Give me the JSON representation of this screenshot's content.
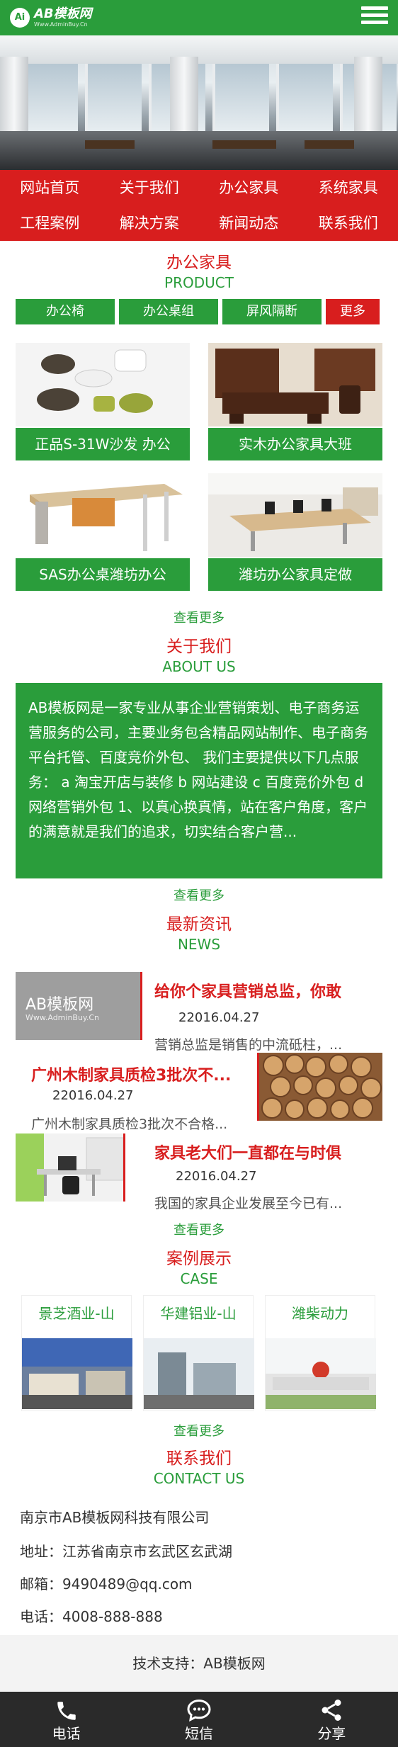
{
  "header": {
    "logo_mark": "Ai",
    "logo_title": "AB模板网",
    "logo_subtitle": "Www.AdminBuy.Cn",
    "menu_icon": "hamburger-icon"
  },
  "nav": [
    "网站首页",
    "关于我们",
    "办公家具",
    "系统家具",
    "工程案例",
    "解决方案",
    "新闻动态",
    "联系我们"
  ],
  "product": {
    "title_cn": "办公家具",
    "title_en": "PRODUCT",
    "tabs": [
      "办公椅",
      "办公桌组",
      "屏风隔断",
      "更多"
    ],
    "items": [
      {
        "caption": "正品S-31W沙发 办公"
      },
      {
        "caption": "实木办公家具大班"
      },
      {
        "caption": "SAS办公桌潍坊办公"
      },
      {
        "caption": "潍坊办公家具定做"
      }
    ],
    "more": "查看更多"
  },
  "about": {
    "title_cn": "关于我们",
    "title_en": "ABOUT US",
    "text": "AB模板网是一家专业从事企业营销策划、电子商务运营服务的公司，主要业务包含精品网站制作、电子商务平台托管、百度竞价外包、 我们主要提供以下几点服务： a 淘宝开店与装修 b 网站建设 c 百度竞价外包 d 网络营销外包 1、以真心换真情，站在客户角度，客户的满意就是我们的追求，切实结合客户营...",
    "more": "查看更多"
  },
  "news": {
    "title_cn": "最新资讯",
    "title_en": "NEWS",
    "thumb1_text": "AB模板网",
    "thumb1_sub": "Www.AdminBuy.Cn",
    "items": [
      {
        "title": "给你个家具营销总监，你敢",
        "date": "22016.04.27",
        "desc": "营销总监是销售的中流砥柱，..."
      },
      {
        "title": "广州木制家具质检3批次不...",
        "date": "22016.04.27",
        "desc": "广州木制家具质检3批次不合格..."
      },
      {
        "title": "家具老大们一直都在与时俱",
        "date": "22016.04.27",
        "desc": "我国的家具企业发展至今已有..."
      }
    ],
    "more": "查看更多"
  },
  "cases": {
    "title_cn": "案例展示",
    "title_en": "CASE",
    "items": [
      {
        "name": "景芝酒业-山"
      },
      {
        "name": "华建铝业-山"
      },
      {
        "name": "潍柴动力"
      }
    ],
    "more": "查看更多"
  },
  "contact": {
    "title_cn": "联系我们",
    "title_en": "CONTACT US",
    "company": "南京市AB模板网科技有限公司",
    "address": "地址：江苏省南京市玄武区玄武湖",
    "email": "邮箱：9490489@qq.com",
    "phone": "电话：4008-888-888"
  },
  "footer": {
    "tech": "技术支持：AB模板网"
  },
  "bottom_bar": [
    {
      "label": "电话",
      "icon": "phone-icon"
    },
    {
      "label": "短信",
      "icon": "message-icon"
    },
    {
      "label": "分享",
      "icon": "share-icon"
    }
  ],
  "colors": {
    "green": "#2a9d3b",
    "red": "#d81e1e",
    "dark": "#2a2a2a"
  }
}
